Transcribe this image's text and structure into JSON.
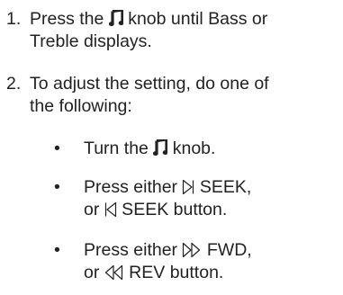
{
  "steps": [
    {
      "number": "1.",
      "line1_before_icon": "Press the ",
      "line1_after_icon": " knob until Bass or",
      "line2": "Treble displays."
    },
    {
      "number": "2.",
      "line1": "To adjust the setting, do one of",
      "line2": "the following:"
    }
  ],
  "bullets": [
    {
      "marker": "•",
      "before_icon": "Turn the ",
      "after_icon": " knob."
    },
    {
      "marker": "•",
      "line1_before_icon": "Press either ",
      "line1_after_icon": " SEEK,",
      "line2_before_icon": "or ",
      "line2_after_icon": " SEEK button."
    },
    {
      "marker": "•",
      "line1_before_icon": "Press either ",
      "line1_after_icon": " FWD,",
      "line2_before_icon": "or ",
      "line2_after_icon": " REV button."
    }
  ],
  "icons": {
    "tone_knob": "music-note-icon",
    "seek_forward": "seek-forward-icon",
    "seek_back": "seek-back-icon",
    "fast_forward": "fast-forward-icon",
    "rewind": "rewind-icon"
  },
  "colors": {
    "text": "#222222",
    "background": "#ffffff"
  }
}
